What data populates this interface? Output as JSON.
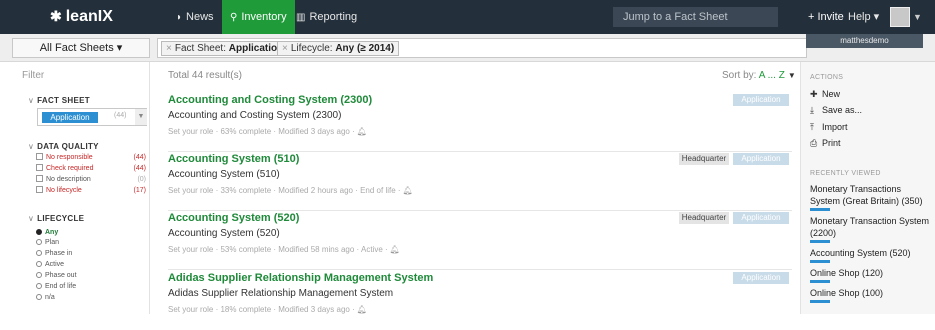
{
  "topbar": {
    "logo_text": "leanIX",
    "nav": [
      {
        "label": "News",
        "icon": "rss-icon"
      },
      {
        "label": "Inventory",
        "icon": "search-icon"
      },
      {
        "label": "Reporting",
        "icon": "bar-chart-icon"
      }
    ],
    "jump_placeholder": "Jump to a Fact Sheet",
    "invite_label": "+ Invite",
    "help_label": "Help ▾",
    "username": "matthesdemo"
  },
  "subbar": {
    "all_fact_sheets": "All Fact Sheets ▾",
    "chips": [
      {
        "prefix": "Fact Sheet:",
        "value": "Application"
      },
      {
        "prefix": "Lifecycle:",
        "value": "Any (≥ 2014)"
      }
    ]
  },
  "filter": {
    "label": "Filter",
    "fact_sheet": {
      "title": "FACT SHEET",
      "selected": "Application",
      "count": "(44)"
    },
    "data_quality": {
      "title": "DATA QUALITY",
      "items": [
        {
          "label": "No responsible",
          "count": "(44)",
          "tone": "red"
        },
        {
          "label": "Check required",
          "count": "(44)",
          "tone": "red"
        },
        {
          "label": "No description",
          "count": "(0)",
          "tone": "grey"
        },
        {
          "label": "No lifecycle",
          "count": "(17)",
          "tone": "red"
        }
      ]
    },
    "lifecycle": {
      "title": "LIFECYCLE",
      "items": [
        {
          "label": "Any",
          "active": true
        },
        {
          "label": "Plan",
          "active": false
        },
        {
          "label": "Phase in",
          "active": false
        },
        {
          "label": "Active",
          "active": false
        },
        {
          "label": "Phase out",
          "active": false
        },
        {
          "label": "End of life",
          "active": false
        },
        {
          "label": "n/a",
          "active": false
        }
      ]
    }
  },
  "results": {
    "total": "Total 44 result(s)",
    "sort_prefix": "Sort by:",
    "sort_value": "A ... Z",
    "items": [
      {
        "title": "Accounting and Costing System (2300)",
        "subtitle": "Accounting and Costing System (2300)",
        "meta": "Set your role · 63% complete · Modified 3 days ago ·",
        "hq": "",
        "badge": "Application"
      },
      {
        "title": "Accounting System (510)",
        "subtitle": "Accounting System (510)",
        "meta": "Set your role · 33% complete · Modified 2 hours ago · End of life ·",
        "hq": "Headquarter",
        "badge": "Application"
      },
      {
        "title": "Accounting System (520)",
        "subtitle": "Accounting System (520)",
        "meta": "Set your role · 53% complete · Modified 58 mins ago · Active ·",
        "hq": "Headquarter",
        "badge": "Application"
      },
      {
        "title": "Adidas Supplier Relationship Management System",
        "subtitle": "Adidas Supplier Relationship Management System",
        "meta": "Set your role · 18% complete · Modified 3 days ago ·",
        "hq": "",
        "badge": "Application"
      }
    ]
  },
  "right_panel": {
    "actions_title": "ACTIONS",
    "actions": [
      {
        "label": "New",
        "icon": "plus-icon"
      },
      {
        "label": "Save as...",
        "icon": "download-icon"
      },
      {
        "label": "Import",
        "icon": "upload-icon"
      },
      {
        "label": "Print",
        "icon": "print-icon"
      }
    ],
    "recent_title": "RECENTLY VIEWED",
    "recent": [
      "Monetary Transactions System (Great Britain) (350)",
      "Monetary Transaction System (2200)",
      "Accounting System (520)",
      "Online Shop (120)",
      "Online Shop (100)"
    ]
  },
  "colors": {
    "topbar": "#232f3a",
    "active_nav": "#1f9b3a",
    "title_green": "#1f8a3a",
    "app_blue": "#2b8fd1"
  }
}
